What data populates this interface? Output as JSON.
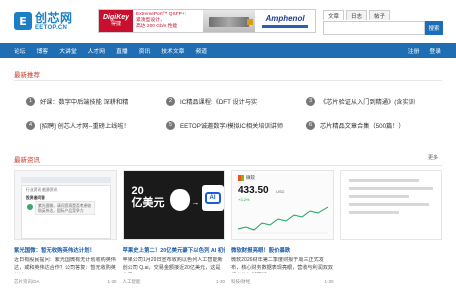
{
  "header": {
    "logo_cn": "创芯网",
    "logo_en": "EETOP.CN",
    "logo_mark": "E"
  },
  "ad": {
    "brand": "DigiKey",
    "brand_sub": "得捷",
    "text_line1": "ExtremePort™ QSFP+:",
    "text_line2": "紧凑型设计，",
    "text_line3": "高达 200 Gb/s 性能",
    "partner": "Amphenol"
  },
  "search": {
    "tabs": [
      "文章",
      "日志",
      "帖子"
    ],
    "active_tab": 0,
    "placeholder": "",
    "button_label": "搜索"
  },
  "nav": {
    "items": [
      "论坛",
      "博客",
      "大讲堂",
      "人才网",
      "直播",
      "资讯",
      "技术文章",
      "频道"
    ],
    "right_items": [
      "注册",
      "登录"
    ]
  },
  "recommend": {
    "title": "最新推荐",
    "items": [
      {
        "num": "1",
        "text": "好课：数字中后端技能 深耕和精"
      },
      {
        "num": "2",
        "text": "IC精品课程:《DFT 设计与实"
      },
      {
        "num": "3",
        "text": "《芯片验证从入门到精通》(含实训"
      },
      {
        "num": "4",
        "text": "[招聘] 创芯人才网--重磅上线啦！"
      },
      {
        "num": "5",
        "text": "EETOP诚邀数字/模拟IC相关培训讲师"
      },
      {
        "num": "6",
        "text": "芯片精品文章合集（500篇！）"
      }
    ]
  },
  "news": {
    "title": "最新资讯",
    "more_label": "更多",
    "cards": [
      {
        "title": "紫光国微：暂无收购英伟达计划！",
        "desc": "近日有股民提问：紫光国微有无计划收购英伟达，或和英伟达合作？公司答复：暂无收购英伟达(NVIDIA)",
        "source": "芯片资讯/DA",
        "date": "1-30",
        "img_tabs": "行业资讯    能源资讯",
        "img_title": "投资者问答",
        "img_text": "紫光国微，请问您再是否考虑收购英伟达，国际产品竞争力"
      },
      {
        "title": "苹果史上第二！20亿美元豪下以色列 AI 初创",
        "desc": "苹果公司1月29日宣布收购以色列人工智能新创公司 Q.ai，交易金额接近20亿美元，这是苹果",
        "source": "人工智能",
        "date": "1-30",
        "img_money": "20\n亿美元",
        "img_ai": "AI"
      },
      {
        "title": "微软财报亮眼！股价暴跌",
        "desc": "微软2026财年第二季度财报于周三正式发布，核心财务数据表现亮眼，营收与利润双双超出华尔街预期",
        "source": "科技/财经",
        "date": "1-30",
        "img_company": "微软",
        "img_price": "433.50",
        "img_currency": "USD",
        "img_change": "+3.2%"
      },
      {
        "title": "",
        "desc": "",
        "source": "",
        "date": ""
      }
    ]
  }
}
